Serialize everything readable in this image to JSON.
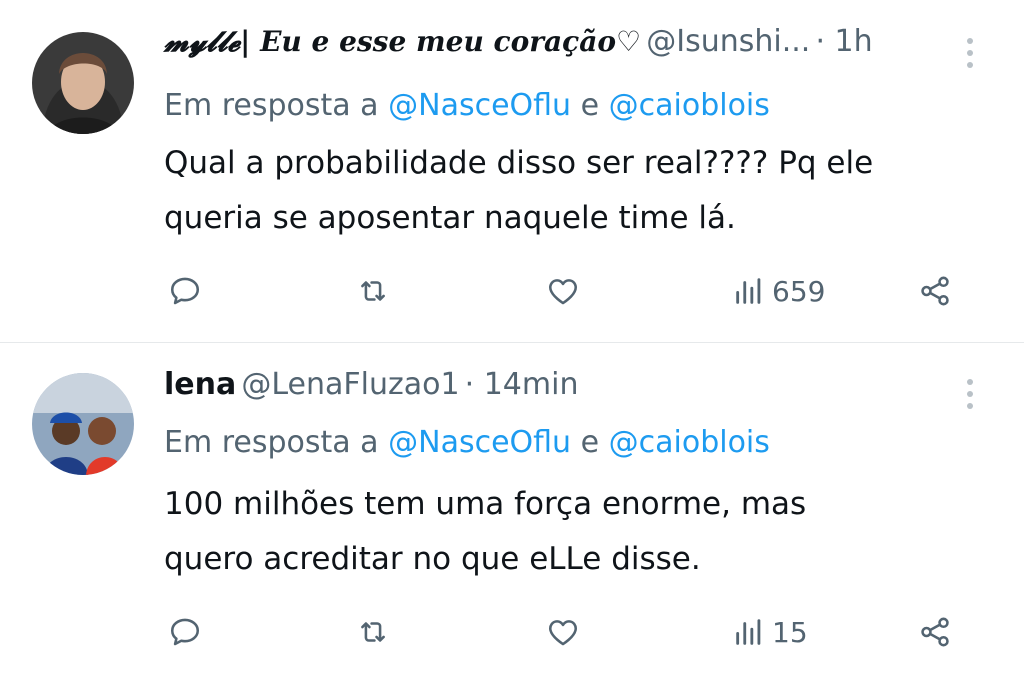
{
  "tweets": [
    {
      "display_name": "𝓶𝔂𝓵𝓵𝓮| Eu e esse meu coração♡",
      "handle": "@Isunshi...",
      "time": "· 1h",
      "reply_prefix": "Em resposta a",
      "mention1": "@NasceOflu",
      "conj": "e",
      "mention2": "@caioblois",
      "text_line1": "Qual a probabilidade disso ser real???? Pq ele",
      "text_line2": "queria se aposentar naquele time lá.",
      "views": "659"
    },
    {
      "display_name": "lena",
      "handle": "@LenaFluzao1",
      "time": "· 14min",
      "reply_prefix": "Em resposta a",
      "mention1": "@NasceOflu",
      "conj": "e",
      "mention2": "@caioblois",
      "text_line1": "100 milhões tem uma força enorme, mas",
      "text_line2": "quero acreditar no que eLLe disse.",
      "views": "15"
    }
  ],
  "icons": [
    "more-vertical-icon",
    "reply-icon",
    "retweet-icon",
    "like-icon",
    "views-icon",
    "share-icon"
  ],
  "colors": {
    "text": "#0f1419",
    "secondary": "#536471",
    "link": "#1d9bf0",
    "divider": "#e6e9eb"
  }
}
